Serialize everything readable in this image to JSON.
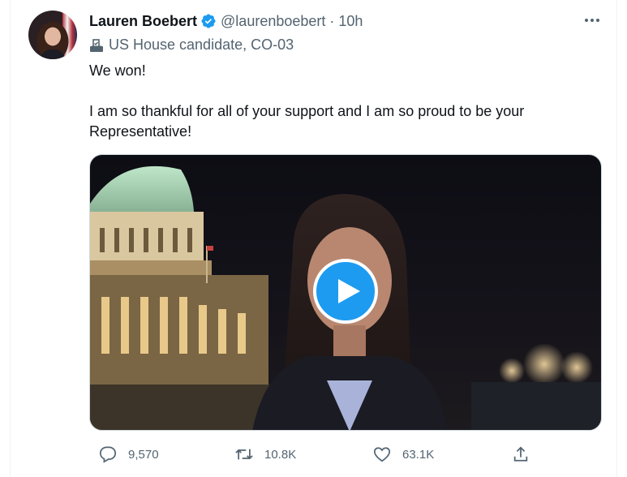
{
  "author": {
    "name": "Lauren Boebert",
    "handle": "@laurenboebert",
    "separator": "·",
    "time": "10h"
  },
  "label": "US House candidate, CO-03",
  "tweet": {
    "line1": "We won!",
    "line2": "I am so thankful for all of your support and I am so proud to be your Representative!"
  },
  "media": {
    "type": "video"
  },
  "actions": {
    "replies": "9,570",
    "retweets": "10.8K",
    "likes": "63.1K"
  },
  "colors": {
    "accent": "#1d9bf0",
    "text": "#0f1419",
    "secondary": "#536471"
  },
  "icons": [
    "verified-badge-icon",
    "ballot-box-icon",
    "more-icon",
    "play-icon",
    "reply-icon",
    "retweet-icon",
    "like-icon",
    "share-icon"
  ]
}
